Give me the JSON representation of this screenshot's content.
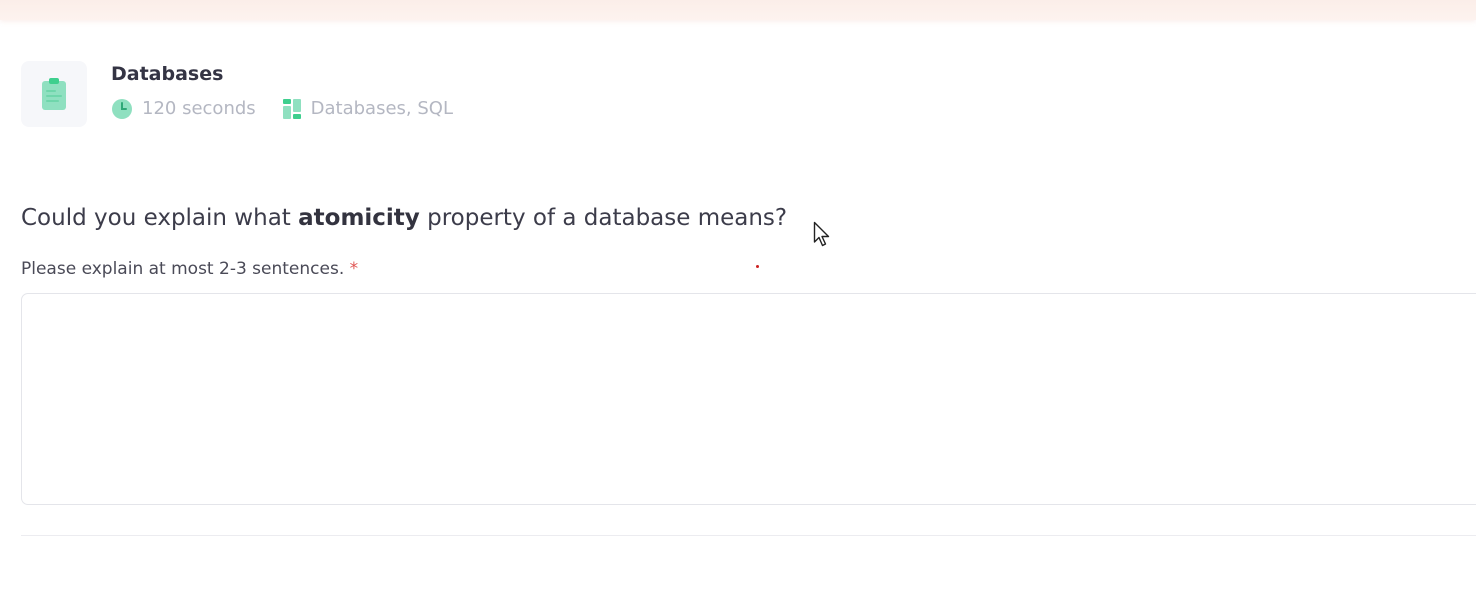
{
  "quiz": {
    "title": "Databases",
    "icon": "clipboard-icon",
    "duration": "120 seconds",
    "topics": "Databases, SQL"
  },
  "question": {
    "prefix": "Could you explain what ",
    "emphasis": "atomicity",
    "suffix": " property of a database means?",
    "hint": "Please explain at most 2-3 sentences.",
    "required_marker": "*"
  },
  "answer": {
    "value": "",
    "placeholder": ""
  },
  "colors": {
    "accent_green": "#3ecf8e",
    "required_red": "#e05553",
    "meta_gray": "#b4b7c2"
  }
}
